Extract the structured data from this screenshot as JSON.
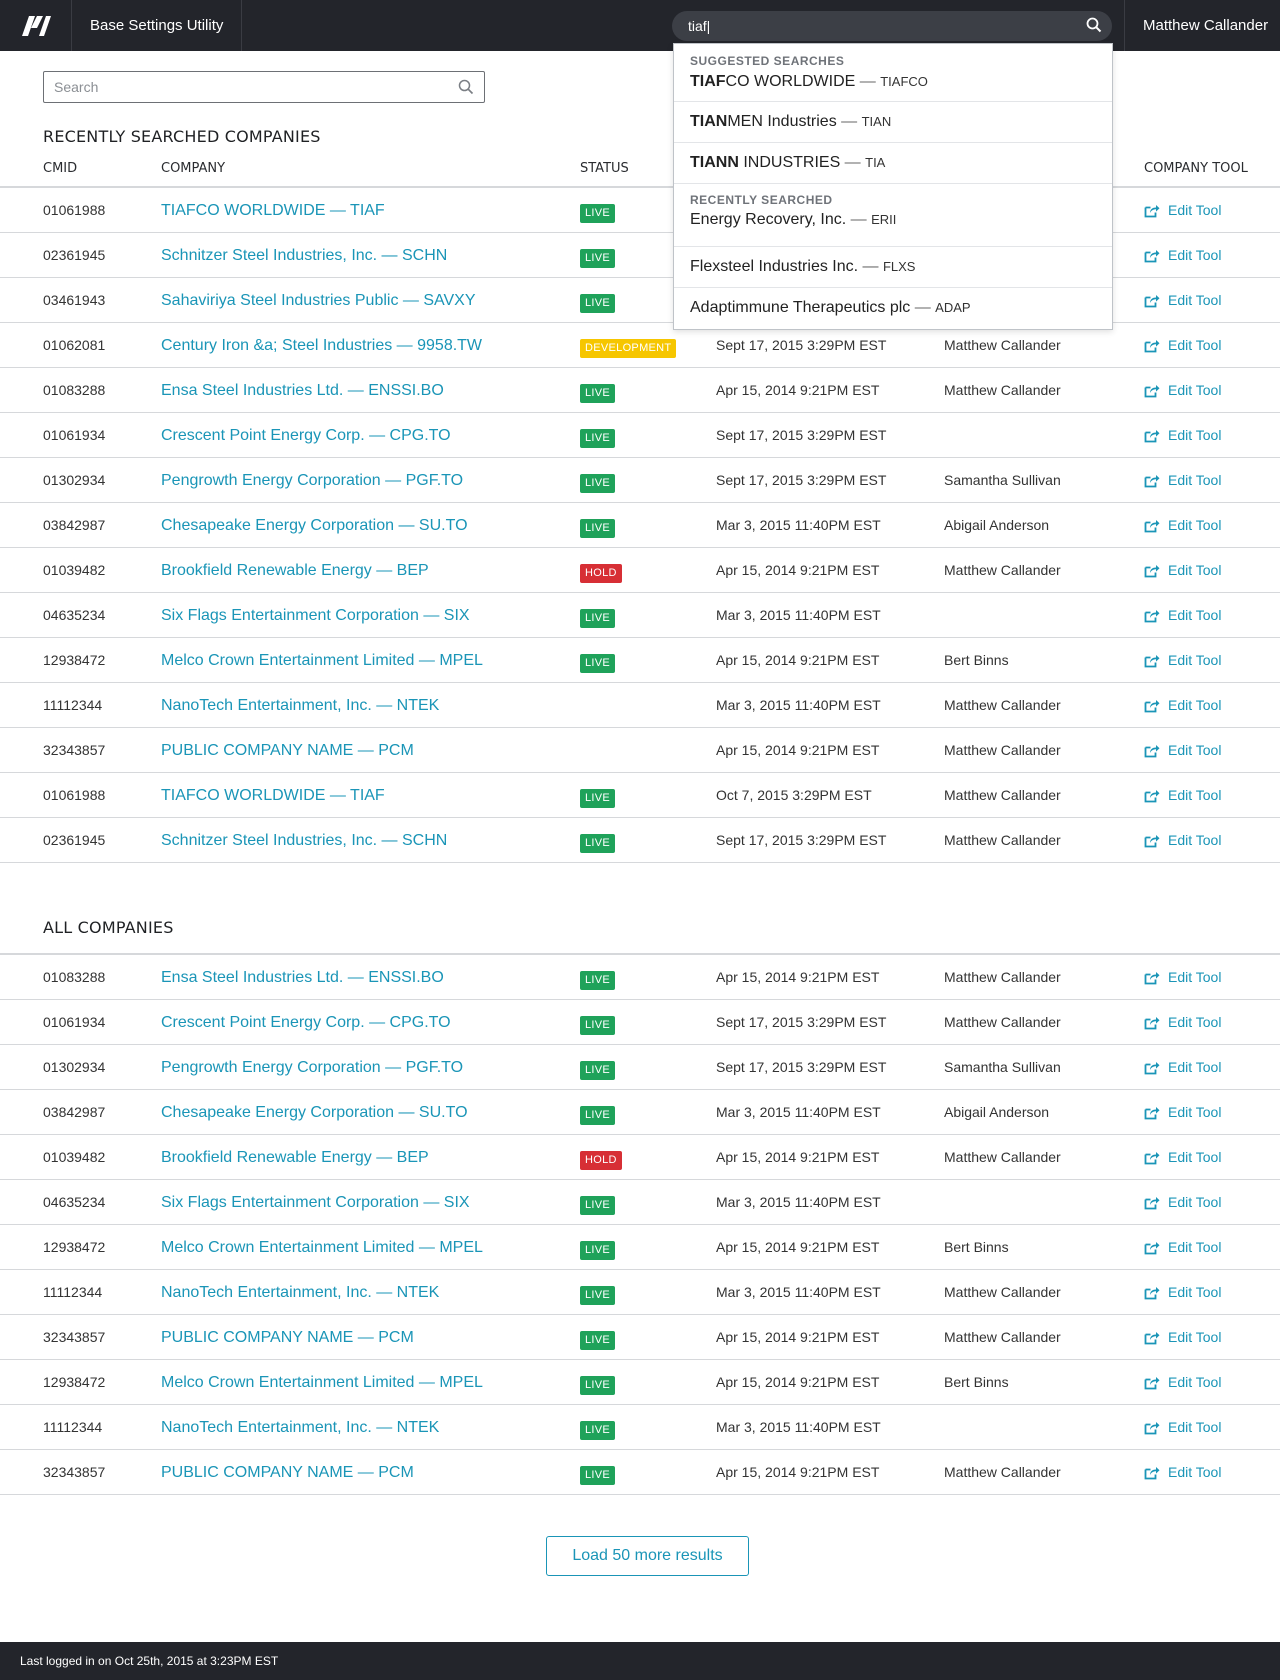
{
  "header": {
    "app_title": "Base Settings Utility",
    "search_value": "tiaf|",
    "user_name": "Matthew Callander"
  },
  "search_dropdown": {
    "suggested_heading": "SUGGESTED SEARCHES",
    "suggested": [
      {
        "bold": "TIAF",
        "rest": "CO WORLDWIDE",
        "ticker": "TIAFCO"
      },
      {
        "bold": "TIAN",
        "rest": "MEN Industries",
        "ticker": "TIAN"
      },
      {
        "bold": "TIANN",
        "rest": " INDUSTRIES",
        "ticker": "TIA"
      }
    ],
    "recent_heading": "RECENTLY SEARCHED",
    "recent": [
      {
        "name": "Energy Recovery, Inc.",
        "ticker": "ERII"
      },
      {
        "name": "Flexsteel Industries Inc.",
        "ticker": "FLXS"
      },
      {
        "name": "Adaptimmune Therapeutics plc",
        "ticker": "ADAP"
      }
    ],
    "separator": " — "
  },
  "page_search": {
    "placeholder": "Search"
  },
  "recent_section": {
    "title": "RECENTLY SEARCHED COMPANIES"
  },
  "columns": {
    "cmid": "CMID",
    "company": "COMPANY",
    "status": "STATUS",
    "tool": "COMPANY TOOL"
  },
  "edit_label": "Edit Tool",
  "recent_rows": [
    {
      "cmid": "01061988",
      "company": "TIAFCO WORLDWIDE — TIAF",
      "status": "LIVE",
      "date": "",
      "by": ""
    },
    {
      "cmid": "02361945",
      "company": "Schnitzer Steel Industries, Inc. — SCHN",
      "status": "LIVE",
      "date": "",
      "by": ""
    },
    {
      "cmid": "03461943",
      "company": "Sahaviriya Steel Industries Public — SAVXY",
      "status": "LIVE",
      "date": "",
      "by": ""
    },
    {
      "cmid": "01062081",
      "company": "Century Iron &a; Steel Industries — 9958.TW",
      "status": "DEVELOPMENT",
      "date": "Sept 17, 2015 3:29PM EST",
      "by": "Matthew Callander"
    },
    {
      "cmid": "01083288",
      "company": "Ensa Steel Industries Ltd. — ENSSI.BO",
      "status": "LIVE",
      "date": "Apr 15, 2014 9:21PM EST",
      "by": "Matthew Callander"
    },
    {
      "cmid": "01061934",
      "company": "Crescent Point Energy Corp. — CPG.TO",
      "status": "LIVE",
      "date": "Sept 17, 2015 3:29PM EST",
      "by": ""
    },
    {
      "cmid": "01302934",
      "company": "Pengrowth Energy Corporation — PGF.TO",
      "status": "LIVE",
      "date": "Sept 17, 2015 3:29PM EST",
      "by": "Samantha Sullivan"
    },
    {
      "cmid": "03842987",
      "company": "Chesapeake Energy Corporation — SU.TO",
      "status": "LIVE",
      "date": "Mar 3, 2015 11:40PM EST",
      "by": "Abigail Anderson"
    },
    {
      "cmid": "01039482",
      "company": "Brookfield Renewable Energy — BEP",
      "status": "HOLD",
      "date": "Apr 15, 2014 9:21PM EST",
      "by": "Matthew Callander"
    },
    {
      "cmid": "04635234",
      "company": "Six Flags Entertainment Corporation — SIX",
      "status": "LIVE",
      "date": "Mar 3, 2015 11:40PM EST",
      "by": ""
    },
    {
      "cmid": "12938472",
      "company": "Melco Crown Entertainment Limited — MPEL",
      "status": "LIVE",
      "date": "Apr 15, 2014 9:21PM EST",
      "by": "Bert Binns"
    },
    {
      "cmid": "11112344",
      "company": "NanoTech Entertainment, Inc. — NTEK",
      "status": "",
      "date": "Mar 3, 2015 11:40PM EST",
      "by": "Matthew Callander"
    },
    {
      "cmid": "32343857",
      "company": "PUBLIC COMPANY NAME — PCM",
      "status": "",
      "date": "Apr 15, 2014 9:21PM EST",
      "by": "Matthew Callander"
    },
    {
      "cmid": "01061988",
      "company": "TIAFCO WORLDWIDE — TIAF",
      "status": "LIVE",
      "date": "Oct 7, 2015 3:29PM EST",
      "by": "Matthew Callander"
    },
    {
      "cmid": "02361945",
      "company": "Schnitzer Steel Industries, Inc. — SCHN",
      "status": "LIVE",
      "date": "Sept 17, 2015 3:29PM EST",
      "by": "Matthew Callander"
    }
  ],
  "all_section": {
    "title": "ALL COMPANIES"
  },
  "all_rows": [
    {
      "cmid": "01083288",
      "company": "Ensa Steel Industries Ltd. — ENSSI.BO",
      "status": "LIVE",
      "date": "Apr 15, 2014 9:21PM EST",
      "by": "Matthew Callander"
    },
    {
      "cmid": "01061934",
      "company": "Crescent Point Energy Corp. — CPG.TO",
      "status": "LIVE",
      "date": "Sept 17, 2015 3:29PM EST",
      "by": "Matthew Callander"
    },
    {
      "cmid": "01302934",
      "company": "Pengrowth Energy Corporation — PGF.TO",
      "status": "LIVE",
      "date": "Sept 17, 2015 3:29PM EST",
      "by": "Samantha Sullivan"
    },
    {
      "cmid": "03842987",
      "company": "Chesapeake Energy Corporation — SU.TO",
      "status": "LIVE",
      "date": "Mar 3, 2015 11:40PM EST",
      "by": "Abigail Anderson"
    },
    {
      "cmid": "01039482",
      "company": "Brookfield Renewable Energy — BEP",
      "status": "HOLD",
      "date": "Apr 15, 2014 9:21PM EST",
      "by": "Matthew Callander"
    },
    {
      "cmid": "04635234",
      "company": "Six Flags Entertainment Corporation — SIX",
      "status": "LIVE",
      "date": "Mar 3, 2015 11:40PM EST",
      "by": ""
    },
    {
      "cmid": "12938472",
      "company": "Melco Crown Entertainment Limited — MPEL",
      "status": "LIVE",
      "date": "Apr 15, 2014 9:21PM EST",
      "by": "Bert Binns"
    },
    {
      "cmid": "11112344",
      "company": "NanoTech Entertainment, Inc. — NTEK",
      "status": "LIVE",
      "date": "Mar 3, 2015 11:40PM EST",
      "by": "Matthew Callander"
    },
    {
      "cmid": "32343857",
      "company": "PUBLIC COMPANY NAME — PCM",
      "status": "LIVE",
      "date": "Apr 15, 2014 9:21PM EST",
      "by": "Matthew Callander"
    },
    {
      "cmid": "12938472",
      "company": "Melco Crown Entertainment Limited — MPEL",
      "status": "LIVE",
      "date": "Apr 15, 2014 9:21PM EST",
      "by": "Bert Binns"
    },
    {
      "cmid": "11112344",
      "company": "NanoTech Entertainment, Inc. — NTEK",
      "status": "LIVE",
      "date": "Mar 3, 2015 11:40PM EST",
      "by": ""
    },
    {
      "cmid": "32343857",
      "company": "PUBLIC COMPANY NAME — PCM",
      "status": "LIVE",
      "date": "Apr 15, 2014 9:21PM EST",
      "by": "Matthew Callander"
    }
  ],
  "load_more_label": "Load 50 more results",
  "footer": {
    "text": "Last logged in on Oct 25th, 2015 at 3:23PM EST"
  },
  "colors": {
    "accent": "#1a95b7",
    "live": "#1fa25a",
    "hold": "#d72f35",
    "development": "#f6c600",
    "topbar": "#23252b"
  },
  "icons": {
    "logo": "brand-logo",
    "search": "search-icon",
    "edit": "edit-share-icon"
  }
}
